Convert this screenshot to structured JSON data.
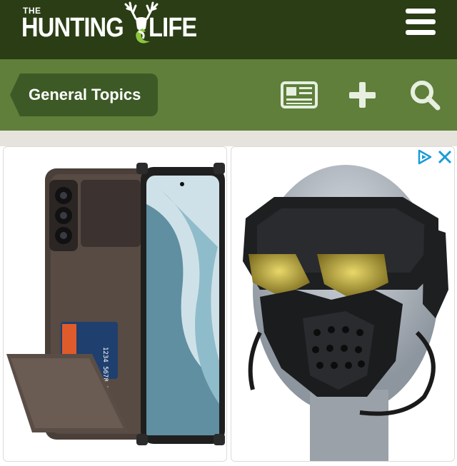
{
  "header": {
    "logo_the": "THE",
    "logo_hunting": "HUNTING",
    "logo_life": "LIFE",
    "menu_icon": "hamburger-menu-icon"
  },
  "subnav": {
    "breadcrumb_label": "General Topics",
    "icons": [
      "newspaper-icon",
      "plus-icon",
      "search-icon"
    ]
  },
  "ads": {
    "left_product": "phone-case-card-holder-image",
    "right_product": "tactical-mask-image",
    "controls": [
      "adchoices-icon",
      "close-icon"
    ]
  },
  "colors": {
    "header_bg": "#2a3d14",
    "subbar_bg": "#5f7f3b",
    "crumb_bg": "#3d5a26",
    "ad_accent": "#1a9bd7"
  }
}
